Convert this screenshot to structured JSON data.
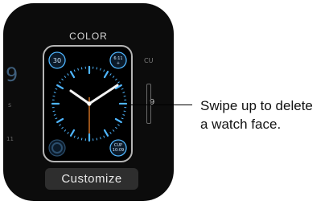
{
  "watch": {
    "title": "COLOR",
    "customize_label": "Customize",
    "complications": {
      "top_left": "30",
      "top_right_line1": "6:11",
      "top_right_line2": "+",
      "bottom_right_line1": "CUP",
      "bottom_right_line2": "10:09"
    },
    "left_peek": {
      "big_digit": "9",
      "small_s": "s",
      "small_bottom": "11"
    },
    "right_peek": {
      "top_text": "CU",
      "digit": "9"
    },
    "accent_color": "#4fb6ff",
    "second_hand_color": "#ff8a2a"
  },
  "callout": {
    "line1": "Swipe up to delete",
    "line2": "a watch face."
  }
}
